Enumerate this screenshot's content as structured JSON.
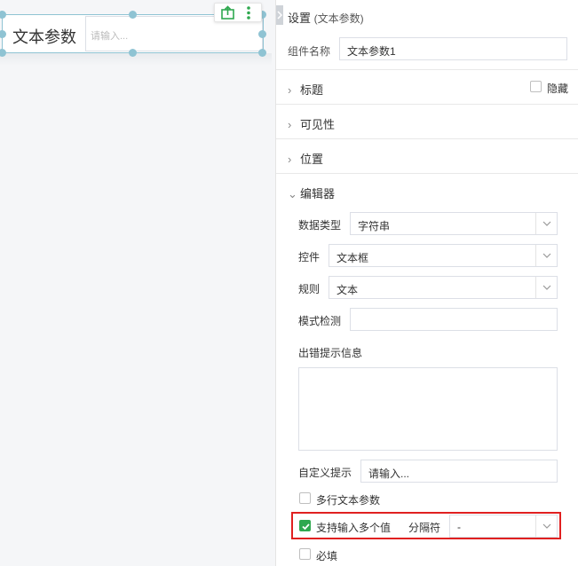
{
  "canvas": {
    "widget": {
      "label": "文本参数",
      "input_placeholder": "请输入..."
    },
    "toolbar": {
      "export_icon": "export-icon",
      "more_icon": "more-vertical-icon"
    }
  },
  "panel": {
    "title": "设置",
    "title_sub": "(文本参数)",
    "component_name_label": "组件名称",
    "component_name_value": "文本参数1",
    "sections": {
      "title": "标题",
      "hidden_label": "隐藏",
      "visibility": "可见性",
      "position": "位置",
      "editor": "编辑器"
    },
    "editor": {
      "data_type_label": "数据类型",
      "data_type_value": "字符串",
      "control_label": "控件",
      "control_value": "文本框",
      "rule_label": "规则",
      "rule_value": "文本",
      "pattern_label": "模式检测",
      "pattern_value": "",
      "error_label": "出错提示信息",
      "error_value": "",
      "custom_hint_label": "自定义提示",
      "custom_hint_value": "请输入...",
      "multiline_label": "多行文本参数",
      "multi_value_label": "支持输入多个值",
      "separator_label": "分隔符",
      "separator_value": "-",
      "required_label": "必填"
    },
    "checks": {
      "hidden": false,
      "multiline": false,
      "multi_value": true,
      "required": false
    }
  },
  "colors": {
    "accent_green": "#2fa84f",
    "handle_blue": "#8fc3d3",
    "highlight_red": "#e02020"
  }
}
